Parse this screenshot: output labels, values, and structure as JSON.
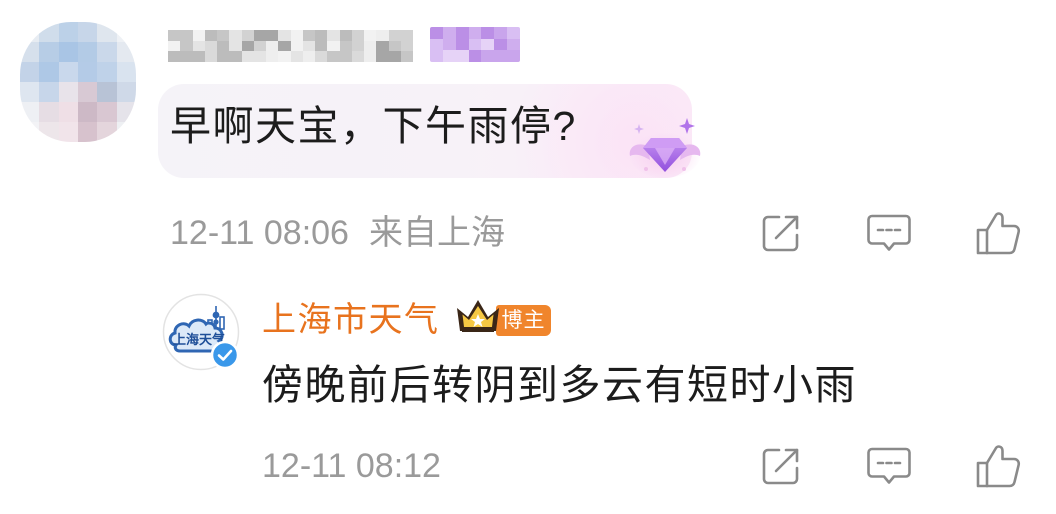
{
  "comment": {
    "text": "早啊天宝，下午雨停?",
    "time": "12-11 08:06",
    "location": "来自上海",
    "bubble_icon": "gem-badge-icon",
    "actions": [
      "share-icon",
      "comment-icon",
      "like-icon"
    ]
  },
  "reply": {
    "username": "上海市天气",
    "avatar_logo_text": "上海天气",
    "title_icon": "crown-icon",
    "role_badge": "博主",
    "verified_icon": "verified-icon",
    "text": "傍晚前后转阴到多云有短时小雨",
    "time": "12-11 08:12",
    "actions": [
      "share-icon",
      "comment-icon",
      "like-icon"
    ]
  },
  "colors": {
    "body_text": "#1c1c1c",
    "meta_text": "#9a9a9a",
    "icon": "#8a8a8a",
    "username": "#e8731e",
    "role_badge": "#f0852c",
    "verified": "#3a98ea",
    "bubble_start": "#f5f3f8",
    "bubble_end": "#fbeef8",
    "gem": "#a865e6"
  }
}
